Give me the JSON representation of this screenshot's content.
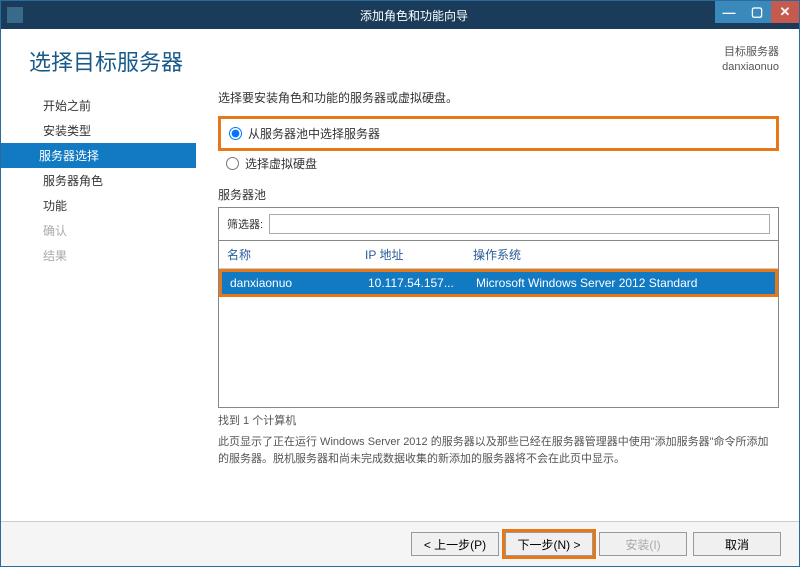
{
  "titlebar": {
    "text": "添加角色和功能向导"
  },
  "header": {
    "title": "选择目标服务器",
    "right_label": "目标服务器",
    "right_value": "danxiaonuo"
  },
  "sidebar": {
    "items": [
      {
        "label": "开始之前",
        "state": "normal"
      },
      {
        "label": "安装类型",
        "state": "normal"
      },
      {
        "label": "服务器选择",
        "state": "selected"
      },
      {
        "label": "服务器角色",
        "state": "normal"
      },
      {
        "label": "功能",
        "state": "normal"
      },
      {
        "label": "确认",
        "state": "disabled"
      },
      {
        "label": "结果",
        "state": "disabled"
      }
    ]
  },
  "main": {
    "instruction": "选择要安装角色和功能的服务器或虚拟硬盘。",
    "radio1": "从服务器池中选择服务器",
    "radio2": "选择虚拟硬盘",
    "pool_label": "服务器池",
    "filter_label": "筛选器:",
    "filter_value": "",
    "columns": {
      "name": "名称",
      "ip": "IP 地址",
      "os": "操作系统"
    },
    "rows": [
      {
        "name": "danxiaonuo",
        "ip": "10.117.54.157...",
        "os": "Microsoft Windows Server 2012 Standard"
      }
    ],
    "count": "找到 1 个计算机",
    "description": "此页显示了正在运行 Windows Server 2012 的服务器以及那些已经在服务器管理器中使用\"添加服务器\"命令所添加的服务器。脱机服务器和尚未完成数据收集的新添加的服务器将不会在此页中显示。"
  },
  "footer": {
    "prev": "< 上一步(P)",
    "next": "下一步(N) >",
    "install": "安装(I)",
    "cancel": "取消"
  }
}
